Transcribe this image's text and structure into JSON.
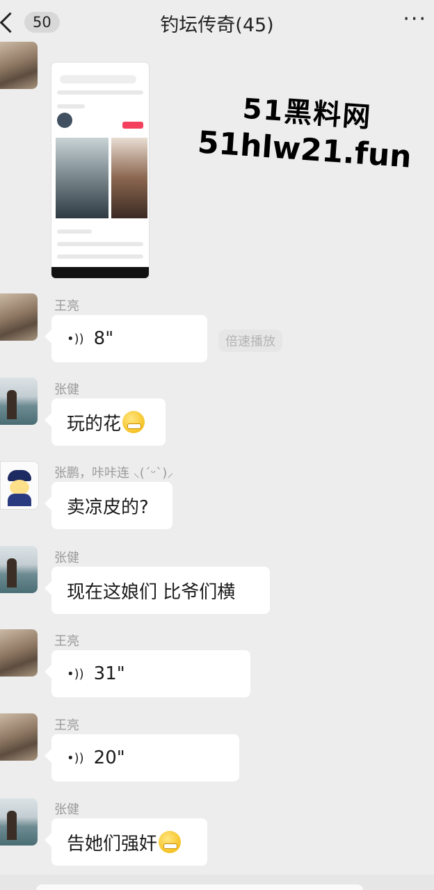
{
  "header": {
    "unread_count": "50",
    "title": "钓坛传奇(45)",
    "more": "···"
  },
  "watermark": {
    "line1": "51黑料网",
    "line2": "51hlw21.fun"
  },
  "messages": [
    {
      "type": "image",
      "avatar": "rock-avatar"
    },
    {
      "type": "voice",
      "sender": "王亮",
      "duration": "8\"",
      "extra": "倍速播放"
    },
    {
      "type": "text",
      "sender": "张健",
      "text": "玩的花",
      "emoji": "laughing-emoji"
    },
    {
      "type": "text",
      "sender": "张鹏，咔咔连 ⸜(ˊᵕˋ)⸝",
      "text": "卖凉皮的?"
    },
    {
      "type": "text",
      "sender": "张健",
      "text": "现在这娘们 比爷们横"
    },
    {
      "type": "voice",
      "sender": "王亮",
      "duration": "31\""
    },
    {
      "type": "voice",
      "sender": "王亮",
      "duration": "20\""
    },
    {
      "type": "text",
      "sender": "张健",
      "text": "告她们强奸",
      "emoji": "grinning-emoji"
    }
  ],
  "colors": {
    "background": "#ededed",
    "bubble": "#ffffff",
    "sender": "#9a9a9a"
  }
}
